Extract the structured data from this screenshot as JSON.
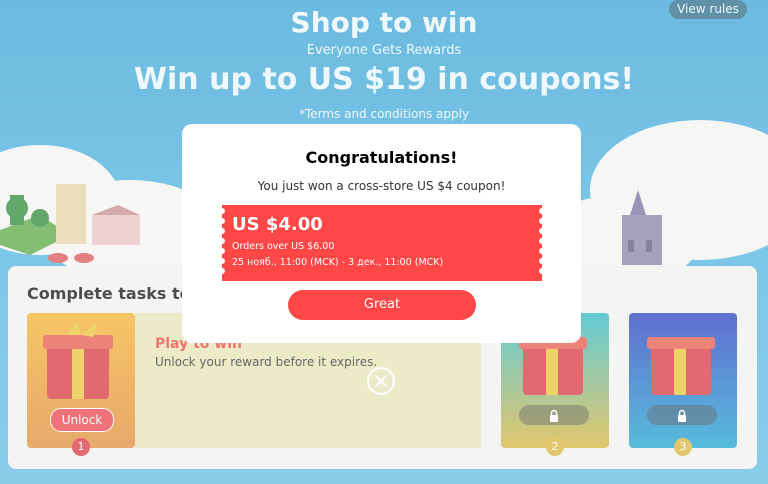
{
  "header": {
    "title": "Shop to win",
    "subtitle": "Everyone Gets Rewards",
    "headline": "Win up to US $19 in coupons!",
    "terms": "*Terms and conditions apply",
    "view_rules": "View rules"
  },
  "tasks_panel": {
    "title": "Complete tasks to get coupons",
    "cards": [
      {
        "number": "1",
        "button": "Unlock",
        "title": "Play to win",
        "description": "Unlock your reward before it expires.",
        "locked": false
      },
      {
        "number": "2",
        "locked": true,
        "lock_icon": "lock-icon"
      },
      {
        "number": "3",
        "locked": true,
        "lock_icon": "lock-icon"
      }
    ]
  },
  "modal": {
    "title": "Congratulations!",
    "subtitle": "You just won a cross-store US $4 coupon!",
    "coupon": {
      "amount": "US $4.00",
      "min_order": "Orders over US $6.00",
      "dates": "25 нояб., 11:00 (MCK) - 3 дек., 11:00 (MCK)"
    },
    "button": "Great",
    "close_icon": "close-icon"
  },
  "colors": {
    "accent": "#ff4747",
    "sky": "#4fb2e0",
    "panel": "#f1f1ef"
  }
}
